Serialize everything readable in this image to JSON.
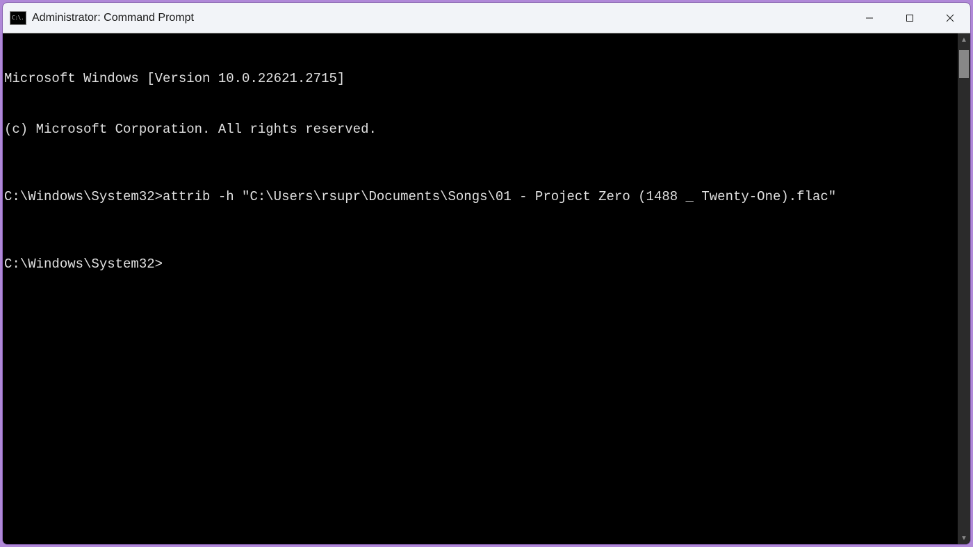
{
  "window": {
    "title": "Administrator: Command Prompt",
    "icon_label": "C:\\."
  },
  "terminal": {
    "lines": [
      "Microsoft Windows [Version 10.0.22621.2715]",
      "(c) Microsoft Corporation. All rights reserved.",
      "",
      "C:\\Windows\\System32>attrib -h \"C:\\Users\\rsupr\\Documents\\Songs\\01 - Project Zero (1488 _ Twenty-One).flac\"",
      "",
      "C:\\Windows\\System32>"
    ],
    "prompt": "C:\\Windows\\System32>",
    "last_command": "attrib -h \"C:\\Users\\rsupr\\Documents\\Songs\\01 - Project Zero (1488 _ Twenty-One).flac\""
  }
}
